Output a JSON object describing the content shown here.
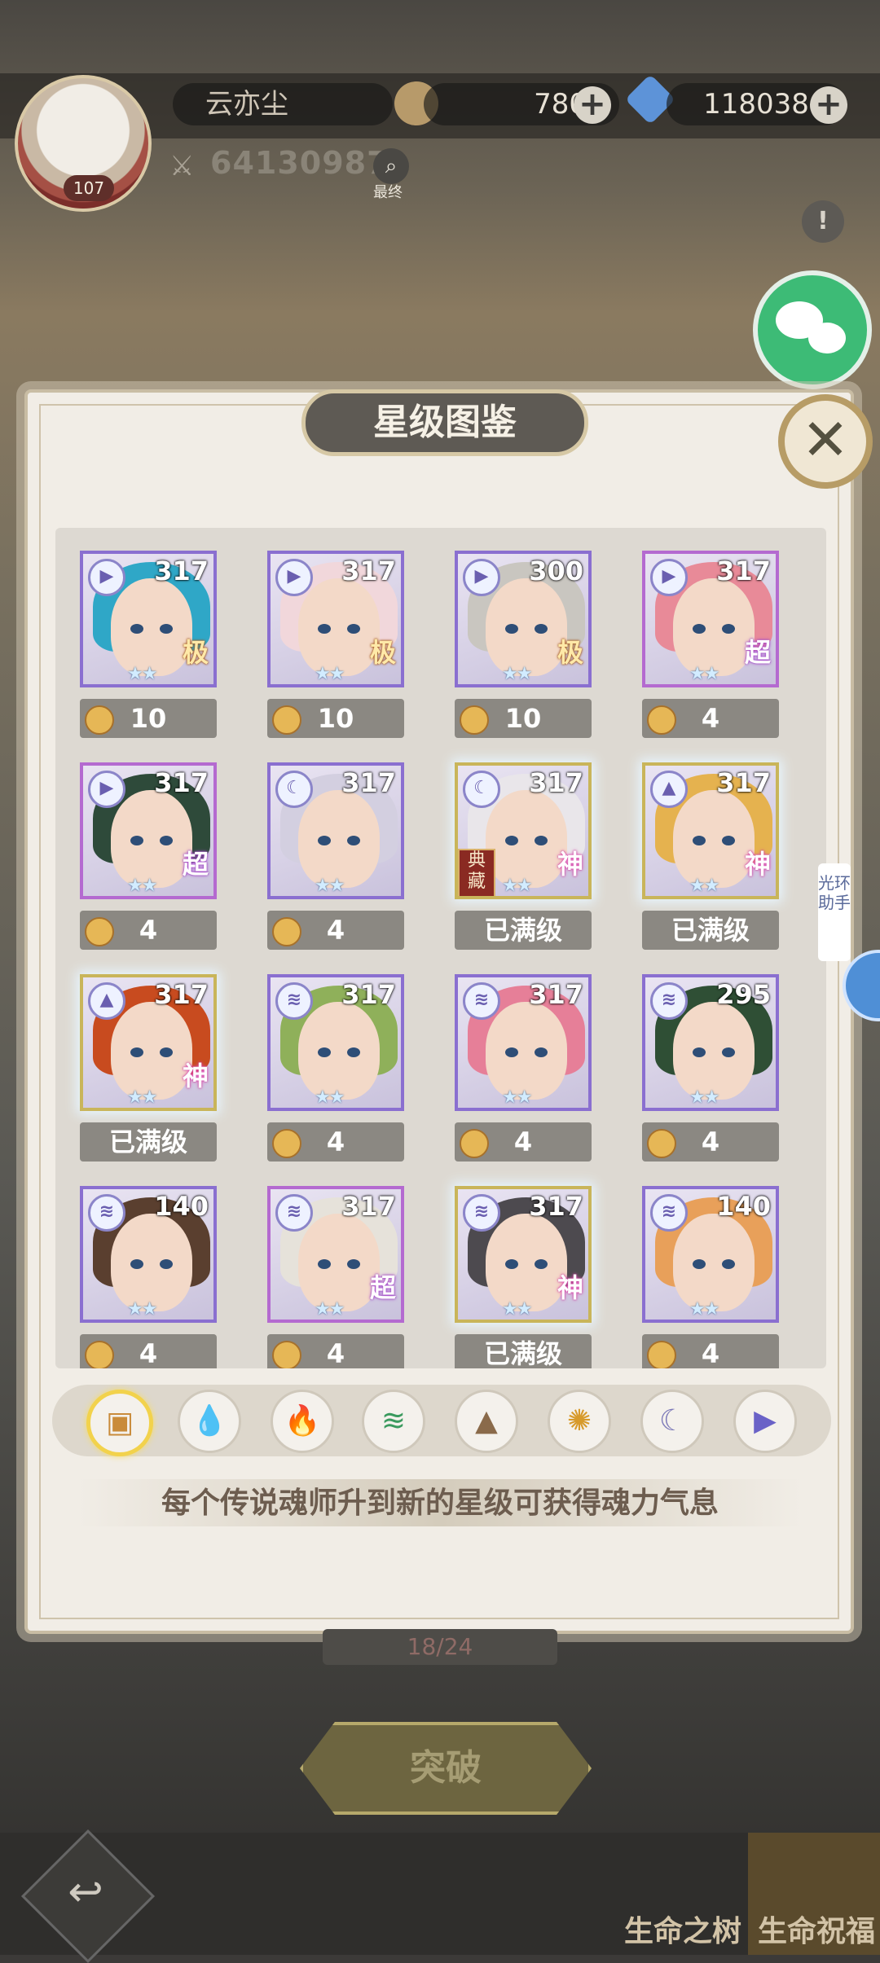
{
  "header": {
    "avatar_level": "107",
    "player_name": "云亦尘",
    "resource1_value": "780",
    "resource2_value": "118038",
    "combat_power": "64130987",
    "search_label": "最终"
  },
  "modal": {
    "title": "星级图鉴",
    "hint": "每个传说魂师升到新的星级可获得魂力气息"
  },
  "cards": [
    {
      "level": "317",
      "grade": "极",
      "bottom": "10",
      "grade_style": "ji",
      "element": "▶",
      "hair": "#2fa7c7",
      "frame": "#8a6fd0"
    },
    {
      "level": "317",
      "grade": "极",
      "bottom": "10",
      "grade_style": "ji",
      "element": "▶",
      "hair": "#f1d7db",
      "frame": "#8a6fd0"
    },
    {
      "level": "300",
      "grade": "极",
      "bottom": "10",
      "grade_style": "ji",
      "element": "▶",
      "hair": "#c9c6c0",
      "frame": "#8a6fd0"
    },
    {
      "level": "317",
      "grade": "超",
      "bottom": "4",
      "grade_style": "chao",
      "element": "▶",
      "hair": "#e88a98",
      "frame": "#b46ad0"
    },
    {
      "level": "317",
      "grade": "超",
      "bottom": "4",
      "grade_style": "chao",
      "element": "▶",
      "hair": "#2e4a3a",
      "frame": "#b46ad0"
    },
    {
      "level": "317",
      "grade": "",
      "bottom": "4",
      "grade_style": "chao",
      "element": "☾",
      "hair": "#d3cfe0",
      "frame": "#8a6fd0"
    },
    {
      "level": "317",
      "grade": "神",
      "bottom": "已满级",
      "grade_style": "shen",
      "element": "☾",
      "hair": "#e9e6ea",
      "frame": "#c9b55a",
      "badge": "典藏"
    },
    {
      "level": "317",
      "grade": "神",
      "bottom": "已满级",
      "grade_style": "shen",
      "element": "▲",
      "hair": "#e5b24f",
      "frame": "#c9b55a"
    },
    {
      "level": "317",
      "grade": "神",
      "bottom": "已满级",
      "grade_style": "shen",
      "element": "▲",
      "hair": "#c84b1f",
      "frame": "#c9b55a"
    },
    {
      "level": "317",
      "grade": "",
      "bottom": "4",
      "grade_style": "chao",
      "element": "≋",
      "hair": "#8fb05a",
      "frame": "#8a6fd0"
    },
    {
      "level": "317",
      "grade": "",
      "bottom": "4",
      "grade_style": "chao",
      "element": "≋",
      "hair": "#e67f98",
      "frame": "#8a6fd0"
    },
    {
      "level": "295",
      "grade": "",
      "bottom": "4",
      "grade_style": "chao",
      "element": "≋",
      "hair": "#2f4f35",
      "frame": "#8a6fd0"
    },
    {
      "level": "140",
      "grade": "",
      "bottom": "4",
      "grade_style": "chao",
      "element": "≋",
      "hair": "#5a3f2f",
      "frame": "#8a6fd0"
    },
    {
      "level": "317",
      "grade": "超",
      "bottom": "4",
      "grade_style": "chao",
      "element": "≋",
      "hair": "#e6e2da",
      "frame": "#b46ad0"
    },
    {
      "level": "317",
      "grade": "神",
      "bottom": "已满级",
      "grade_style": "shen",
      "element": "≋",
      "hair": "#4d4a4f",
      "frame": "#c9b55a"
    },
    {
      "level": "140",
      "grade": "",
      "bottom": "4",
      "grade_style": "chao",
      "element": "≋",
      "hair": "#e8a05a",
      "frame": "#8a6fd0"
    }
  ],
  "filters": [
    {
      "name": "all",
      "icon": "▣",
      "color": "#c98b3a"
    },
    {
      "name": "water",
      "icon": "💧",
      "color": "#3b8fd6"
    },
    {
      "name": "fire",
      "icon": "🔥",
      "color": "#d2513b"
    },
    {
      "name": "wind",
      "icon": "≋",
      "color": "#3a9a5e"
    },
    {
      "name": "earth",
      "icon": "▲",
      "color": "#8a6a4a"
    },
    {
      "name": "light",
      "icon": "✺",
      "color": "#d79a2b"
    },
    {
      "name": "dark",
      "icon": "☾",
      "color": "#7b78b8"
    },
    {
      "name": "thunder",
      "icon": "▶",
      "color": "#6a62c7"
    }
  ],
  "side_tab_label": "光环助手",
  "bottom": {
    "progress_text": "18/24",
    "breakthrough_label": "突破",
    "nav_tree_label": "生命之树",
    "nav_bless_label": "生命祝福"
  },
  "colors": {
    "accent_gold": "#c9a95a",
    "modal_bg": "#f1ede6",
    "title_bg": "#5e5a54",
    "bar_bg": "#8b8882"
  }
}
